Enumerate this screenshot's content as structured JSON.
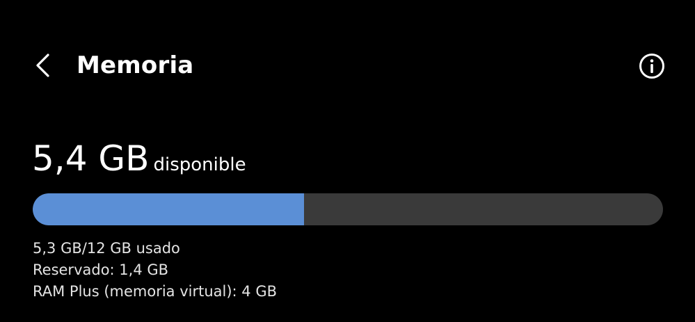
{
  "header": {
    "title": "Memoria",
    "back_icon": "chevron-left-icon",
    "info_icon": "info-icon"
  },
  "memory": {
    "available_value": "5,4 GB",
    "available_label": "disponible",
    "used_fraction": 0.43,
    "used_text": "5,3 GB/12 GB usado",
    "reserved_text": "Reservado: 1,4 GB",
    "ram_plus_text": "RAM Plus (memoria virtual): 4 GB"
  },
  "colors": {
    "background": "#000000",
    "bar_used": "#5b8fd6",
    "bar_track": "#3a3a3a",
    "text": "#ffffff"
  }
}
